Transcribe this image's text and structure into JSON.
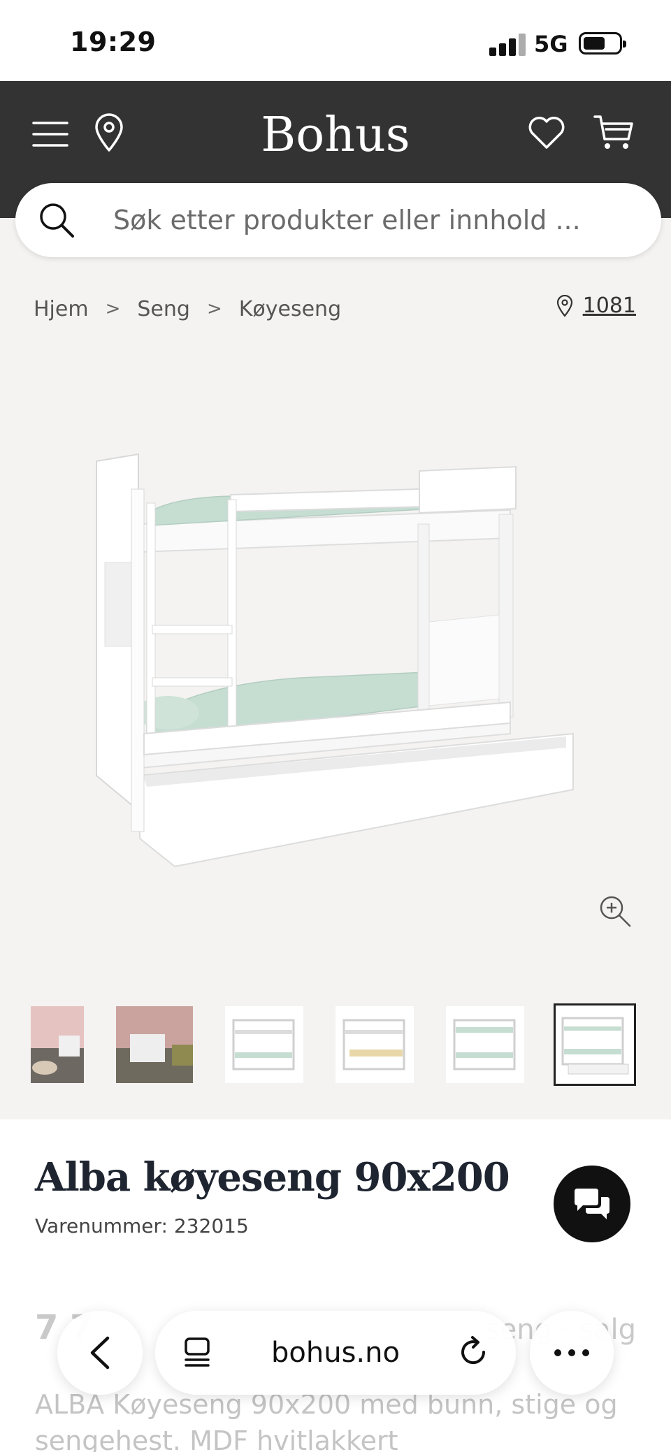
{
  "status_bar": {
    "time": "19:29",
    "network": "5G"
  },
  "header": {
    "logo": "Bohus",
    "icons": [
      "menu-icon",
      "location-icon",
      "heart-icon",
      "cart-icon"
    ],
    "background": "#333333"
  },
  "search": {
    "placeholder": "Søk etter produkter eller innhold ..."
  },
  "breadcrumb": {
    "items": [
      "Hjem",
      "Seng",
      "Køyeseng"
    ],
    "store_number": "1081"
  },
  "gallery": {
    "thumbnail_count": 6,
    "selected_index": 5
  },
  "product": {
    "title": "Alba køyeseng 90x200",
    "sku": "Varenummer: 232015",
    "price_partial": "7 7",
    "availability_partial": "seng · salg",
    "description": "ALBA Køyeseng 90x200 med bunn, stige og sengehest. MDF hvitlakkert"
  },
  "browser": {
    "url": "bohus.no"
  }
}
